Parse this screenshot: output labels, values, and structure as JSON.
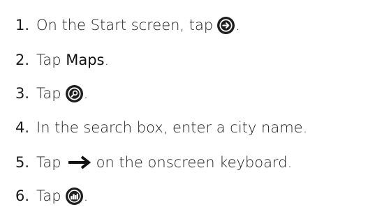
{
  "steps": [
    {
      "num": "1.",
      "before": "On the Start screen, tap",
      "after": ".",
      "icon": "arrow-right-circle-icon"
    },
    {
      "num": "2.",
      "before": "Tap ",
      "bold": "Maps",
      "after": "."
    },
    {
      "num": "3.",
      "before": "Tap",
      "after": ".",
      "icon": "search-circle-icon"
    },
    {
      "num": "4.",
      "before": "In the search box, enter a city name."
    },
    {
      "num": "5.",
      "before": "Tap",
      "after": "on the onscreen keyboard.",
      "icon": "right-arrow-icon"
    },
    {
      "num": "6.",
      "before": "Tap",
      "after": ".",
      "icon": "city-circle-icon"
    }
  ]
}
